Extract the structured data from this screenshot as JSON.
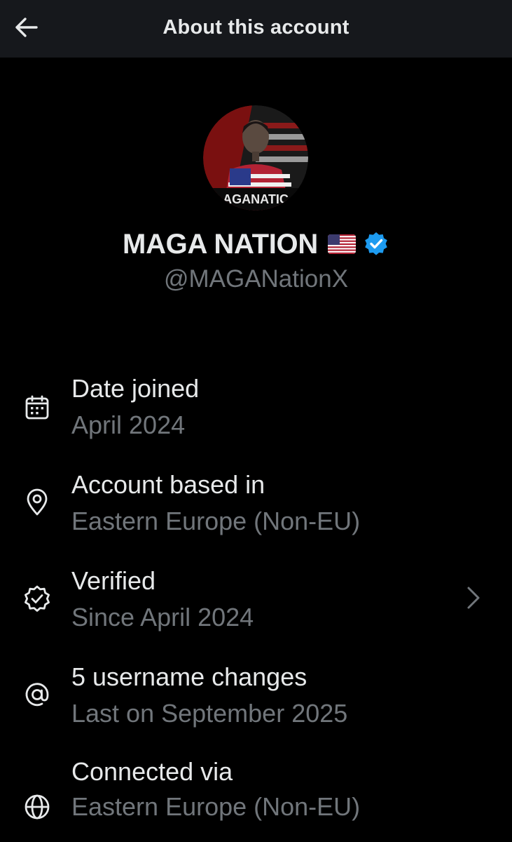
{
  "header": {
    "title": "About this account",
    "back_icon": "arrow-left-icon"
  },
  "profile": {
    "display_name": "MAGA NATION",
    "handle": "@MAGANationX",
    "avatar_text": "AGANATIC",
    "flag_icon": "us-flag-icon",
    "verified_icon": "verified-badge-icon",
    "verified_color": "#1d9bf0"
  },
  "info": {
    "date_joined": {
      "icon": "calendar-icon",
      "title": "Date joined",
      "value": "April 2024"
    },
    "account_based": {
      "icon": "location-pin-icon",
      "title": "Account based in",
      "value": "Eastern Europe (Non-EU)"
    },
    "verified": {
      "icon": "verified-outline-icon",
      "title": "Verified",
      "value": "Since April 2024",
      "chevron_icon": "chevron-right-icon"
    },
    "username_changes": {
      "icon": "at-sign-icon",
      "title": "5 username changes",
      "value": "Last on September 2025"
    },
    "connected_via": {
      "icon": "globe-icon",
      "title": "Connected via",
      "value": "Eastern Europe (Non-EU)"
    }
  },
  "colors": {
    "background": "#000000",
    "header_background": "#16181c",
    "primary_text": "#e7e9ea",
    "secondary_text": "#71767b"
  }
}
